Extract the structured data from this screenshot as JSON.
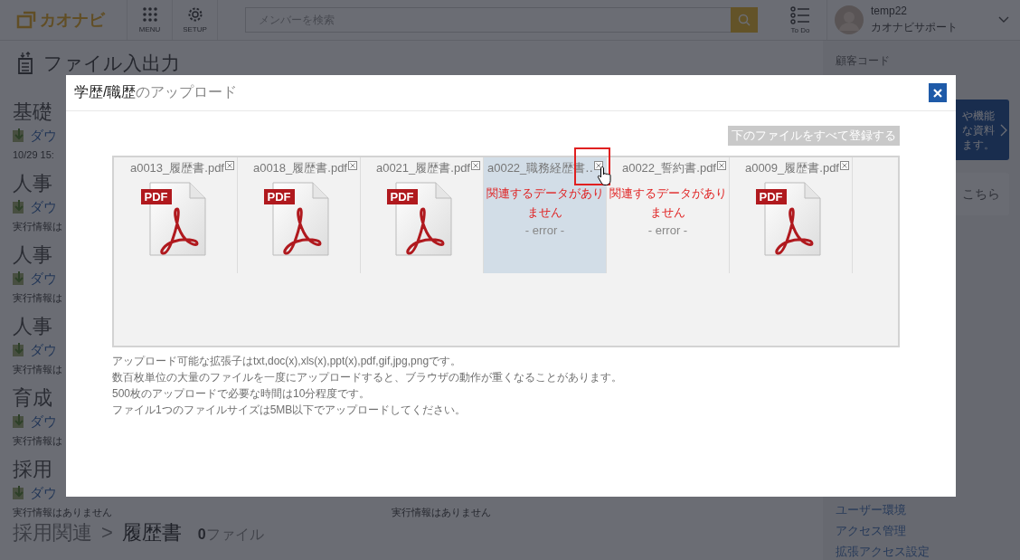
{
  "header": {
    "logo": "カオナビ",
    "nav": [
      {
        "kind": "menu",
        "label": "MENU"
      },
      {
        "kind": "setup",
        "label": "SETUP"
      }
    ],
    "search": {
      "placeholder": "メンバーを検索"
    },
    "todo": "To Do",
    "user": {
      "name": "temp22",
      "org": "カオナビサポート"
    }
  },
  "page_title": "ファイル入出力",
  "sections": [
    {
      "heading": "基礎",
      "link": "ダウ",
      "info": "10/29 15:"
    },
    {
      "heading": "人事",
      "link": "ダウ",
      "info": "実行情報は"
    },
    {
      "heading": "人事",
      "link": "ダウ",
      "info": "実行情報は"
    },
    {
      "heading": "人事",
      "link": "ダウ",
      "info": "実行情報は"
    },
    {
      "heading": "育成",
      "link": "ダウ",
      "info": "実行情報は"
    },
    {
      "heading": "採用",
      "link": "ダウ",
      "info": "実行情報はありません",
      "info_2": "実行情報はありません"
    }
  ],
  "breadcrumb": {
    "parent": "採用関連",
    "separator": ">",
    "current": "履歴書",
    "count": "0",
    "count_label": "ファイル"
  },
  "sidebar": {
    "label": "顧客コード",
    "promo_lines": [
      "や機能",
      "な資料",
      "ます。"
    ],
    "help": "こちら",
    "links": [
      "ユーザー環境",
      "アクセス管理",
      "拡張アクセス設定"
    ]
  },
  "dialog": {
    "title_main": "学歴/職歴",
    "title_rest": "のアップロード",
    "register_button": {
      "label": "下のファイルをすべて登録する",
      "disabled": true
    },
    "files": [
      {
        "name": "a0013_履歴書.pdf",
        "kind": "pdf",
        "badge": "PDF",
        "selected": false
      },
      {
        "name": "a0018_履歴書.pdf",
        "kind": "pdf",
        "badge": "PDF",
        "selected": false
      },
      {
        "name": "a0021_履歴書.pdf",
        "kind": "pdf",
        "badge": "PDF",
        "selected": false
      },
      {
        "name": "a0022_職務経歴書‥",
        "kind": "error",
        "message": "関連するデータがありません",
        "error_label": "- error -",
        "selected": true
      },
      {
        "name": "a0022_誓約書.pdf",
        "kind": "error",
        "message": "関連するデータがありません",
        "error_label": "- error -",
        "selected": false
      },
      {
        "name": "a0009_履歴書.pdf",
        "kind": "pdf",
        "badge": "PDF",
        "selected": false
      }
    ],
    "notes": [
      "アップロード可能な拡張子はtxt,doc(x),xls(x),ppt(x),pdf,gif,jpg,pngです。",
      "数百枚単位の大量のファイルを一度にアップロードすると、ブラウザの動作が重くなることがあります。",
      "500枚のアップロードで必要な時間は10分程度です。",
      "ファイル1つのファイルサイズは5MB以下でアップロードしてください。"
    ]
  }
}
